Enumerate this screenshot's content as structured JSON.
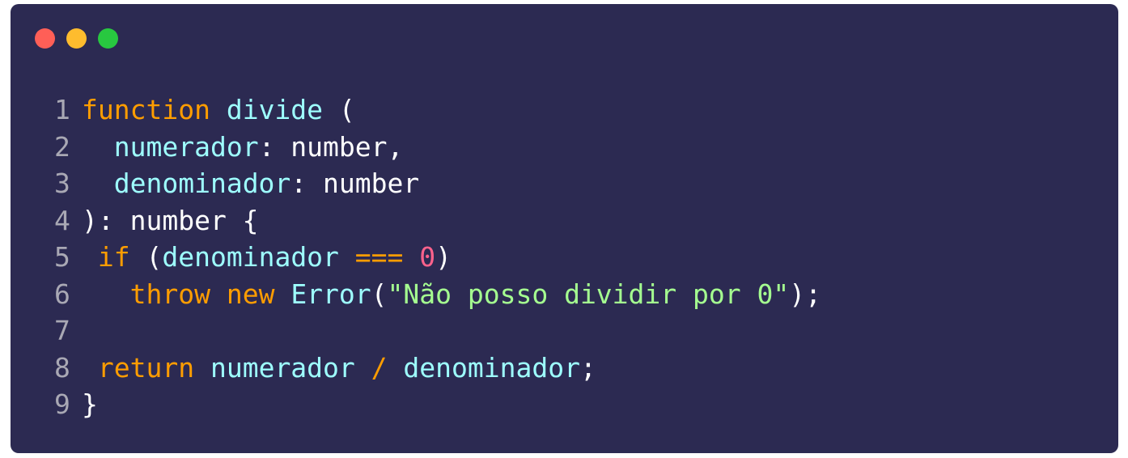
{
  "colors": {
    "background": "#2c2a52",
    "dot_close": "#ff5f57",
    "dot_minimize": "#febc2e",
    "dot_maximize": "#28c840",
    "keyword": "#ff9d00",
    "identifier": "#9effff",
    "plain": "#ffffff",
    "number": "#ff628c",
    "string": "#a5ff90",
    "line_number": "#a9a8b4"
  },
  "code": {
    "lines": [
      {
        "number": "1",
        "tokens": [
          {
            "text": "function",
            "kind": "keyword"
          },
          {
            "text": " ",
            "kind": "plain"
          },
          {
            "text": "divide",
            "kind": "identifier"
          },
          {
            "text": " (",
            "kind": "plain"
          }
        ]
      },
      {
        "number": "2",
        "tokens": [
          {
            "text": "  ",
            "kind": "plain"
          },
          {
            "text": "numerador",
            "kind": "identifier"
          },
          {
            "text": ": number,",
            "kind": "plain"
          }
        ]
      },
      {
        "number": "3",
        "tokens": [
          {
            "text": "  ",
            "kind": "plain"
          },
          {
            "text": "denominador",
            "kind": "identifier"
          },
          {
            "text": ": number",
            "kind": "plain"
          }
        ]
      },
      {
        "number": "4",
        "tokens": [
          {
            "text": "): number {",
            "kind": "plain"
          }
        ]
      },
      {
        "number": "5",
        "tokens": [
          {
            "text": " ",
            "kind": "plain"
          },
          {
            "text": "if",
            "kind": "keyword"
          },
          {
            "text": " (",
            "kind": "plain"
          },
          {
            "text": "denominador",
            "kind": "identifier"
          },
          {
            "text": " ",
            "kind": "plain"
          },
          {
            "text": "===",
            "kind": "keyword"
          },
          {
            "text": " ",
            "kind": "plain"
          },
          {
            "text": "0",
            "kind": "number"
          },
          {
            "text": ")",
            "kind": "plain"
          }
        ]
      },
      {
        "number": "6",
        "tokens": [
          {
            "text": "   ",
            "kind": "plain"
          },
          {
            "text": "throw",
            "kind": "keyword"
          },
          {
            "text": " ",
            "kind": "plain"
          },
          {
            "text": "new",
            "kind": "keyword"
          },
          {
            "text": " ",
            "kind": "plain"
          },
          {
            "text": "Error",
            "kind": "identifier"
          },
          {
            "text": "(",
            "kind": "plain"
          },
          {
            "text": "\"Não posso dividir por 0\"",
            "kind": "string"
          },
          {
            "text": ");",
            "kind": "plain"
          }
        ]
      },
      {
        "number": "7",
        "tokens": []
      },
      {
        "number": "8",
        "tokens": [
          {
            "text": " ",
            "kind": "plain"
          },
          {
            "text": "return",
            "kind": "keyword"
          },
          {
            "text": " ",
            "kind": "plain"
          },
          {
            "text": "numerador",
            "kind": "identifier"
          },
          {
            "text": " ",
            "kind": "plain"
          },
          {
            "text": "/",
            "kind": "keyword"
          },
          {
            "text": " ",
            "kind": "plain"
          },
          {
            "text": "denominador",
            "kind": "identifier"
          },
          {
            "text": ";",
            "kind": "plain"
          }
        ]
      },
      {
        "number": "9",
        "tokens": [
          {
            "text": "}",
            "kind": "plain"
          }
        ]
      }
    ]
  }
}
